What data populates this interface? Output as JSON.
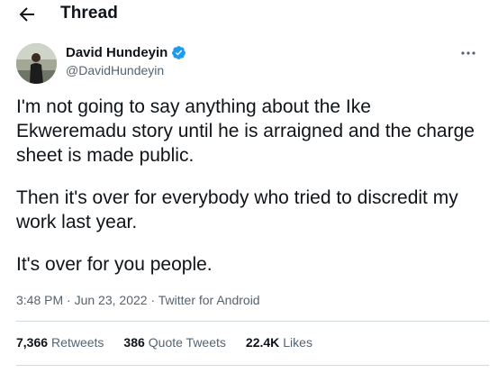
{
  "header": {
    "back_icon": "arrow-left-icon",
    "title": "Thread"
  },
  "author": {
    "name": "David Hundeyin",
    "handle": "@DavidHundeyin",
    "verified_icon": "verified-badge-icon",
    "verified_color": "#1d9bf0"
  },
  "more_icon": "more-horizontal-icon",
  "tweet": {
    "lines": [
      "I'm not going to say anything about the Ike",
      "Ekweremadu story until he is arraigned and the charge",
      "sheet is made public.",
      "Then it's over for everybody who tried to discredit my",
      "work last year.",
      "It's over for you people."
    ]
  },
  "meta": {
    "time": "3:48 PM",
    "separator": " · ",
    "date": "Jun 23, 2022",
    "source": "Twitter for Android"
  },
  "stats": {
    "retweets_count": "7,366",
    "retweets_label": "Retweets",
    "quotes_count": "386",
    "quotes_label": "Quote Tweets",
    "likes_count": "22.4K",
    "likes_label": "Likes"
  }
}
